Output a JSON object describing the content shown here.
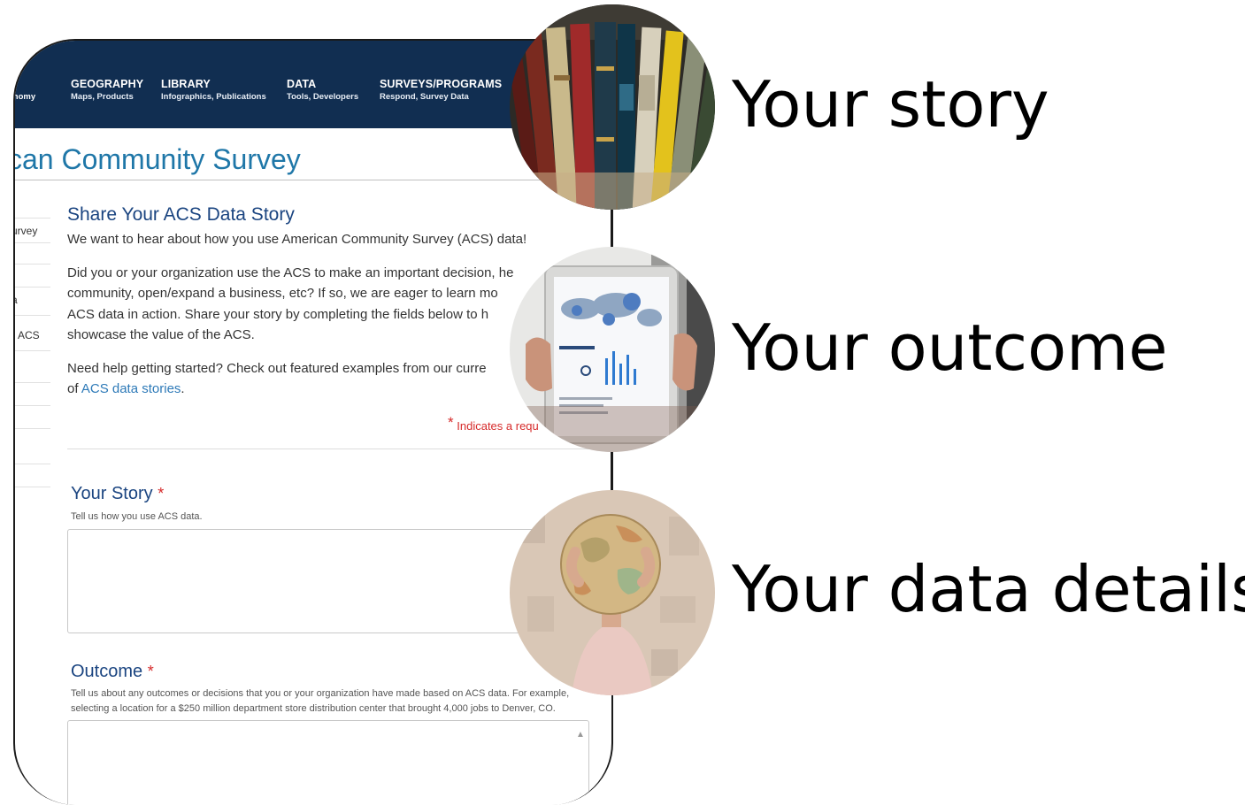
{
  "nav": {
    "cut_sub": "onomy",
    "items": [
      {
        "title": "GEOGRAPHY",
        "sub": "Maps, Products"
      },
      {
        "title": "LIBRARY",
        "sub": "Infographics, Publications"
      },
      {
        "title": "DATA",
        "sub": "Tools, Developers"
      },
      {
        "title": "SURVEYS/PROGRAMS",
        "sub": "Respond, Survey Data"
      }
    ]
  },
  "page": {
    "title": "can Community Survey"
  },
  "sidebar": {
    "items": [
      "urvey",
      "a",
      "ACS"
    ]
  },
  "content": {
    "heading": "Share Your ACS Data Story",
    "intro": "We want to hear about how you use American Community Survey (ACS) data!",
    "para1": "Did you or your organization use the ACS to make an important decision, he",
    "para1b": "community, open/expand a business, etc? If so, we are eager to learn mo",
    "para1c": "ACS data in action. Share your story by completing the fields below to h",
    "para1d": "showcase the value of the ACS.",
    "para2": "Need help getting started? Check out featured examples from our curre",
    "para2b": "of ",
    "para2_link": "ACS data stories",
    "para2_end": ".",
    "required_star": "*",
    "required_note": "Indicates a requ"
  },
  "form": {
    "story": {
      "label": "Your Story",
      "star": "*",
      "help": "Tell us how you use ACS data."
    },
    "outcome": {
      "label": "Outcome",
      "star": "*",
      "help_line1": "Tell us about any outcomes or decisions that you or your organization have made based on ACS data. For example,",
      "help_line2": "selecting a location for a $250 million department store distribution center that brought 4,000 jobs to Denver, CO."
    }
  },
  "callouts": [
    {
      "caption": "Your story",
      "icon": "books-photo"
    },
    {
      "caption": "Your outcome",
      "icon": "tablet-dashboard-photo"
    },
    {
      "caption": "Your data details",
      "icon": "globe-photo"
    }
  ],
  "colors": {
    "navbar": "#112e51",
    "title_blue": "#1f77a8",
    "heading_navy": "#1a4480",
    "link": "#2e7ab8",
    "required_red": "#d62b2b"
  }
}
